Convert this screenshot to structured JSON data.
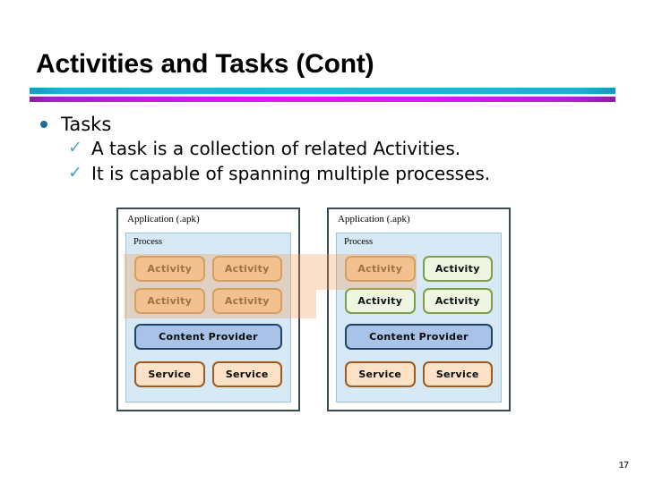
{
  "slide": {
    "title": "Activities and Tasks (Cont)",
    "page_number": "17"
  },
  "colors": {
    "divider_top": "#19bcdc",
    "divider_bottom": "#e915f5",
    "bullet_dot": "#1d6e92",
    "check_mark": "#4ba6c2",
    "activity_tan_fill": "#f2d3ab",
    "activity_tan_border": "#c9a263",
    "activity_green_fill": "#eef5e1",
    "activity_green_border": "#7f9e4a",
    "content_provider_fill": "#a9c3e8",
    "content_provider_border": "#1f4468",
    "service_fill": "#fde2c8",
    "service_border": "#a05a1b",
    "process_fill": "#d7e9f4",
    "application_border": "#3c4a52",
    "highlight_band": "#f1974e"
  },
  "bullets": {
    "level1": "Tasks",
    "check_glyph": "✓",
    "level2": [
      "A task is a collection of related Activities.",
      "It is capable of spanning multiple processes."
    ]
  },
  "diagrams": [
    {
      "id": "left",
      "app_label": "Application (.apk)",
      "process_label": "Process",
      "activities_row1": [
        "Activity",
        "Activity"
      ],
      "activities_row2": [
        "Activity",
        "Activity"
      ],
      "content_provider": "Content Provider",
      "services": [
        "Service",
        "Service"
      ]
    },
    {
      "id": "right",
      "app_label": "Application (.apk)",
      "process_label": "Process",
      "activities_row1": [
        "Activity",
        "Activity"
      ],
      "activities_row2": [
        "Activity",
        "Activity"
      ],
      "content_provider": "Content Provider",
      "services": [
        "Service",
        "Service"
      ]
    }
  ]
}
